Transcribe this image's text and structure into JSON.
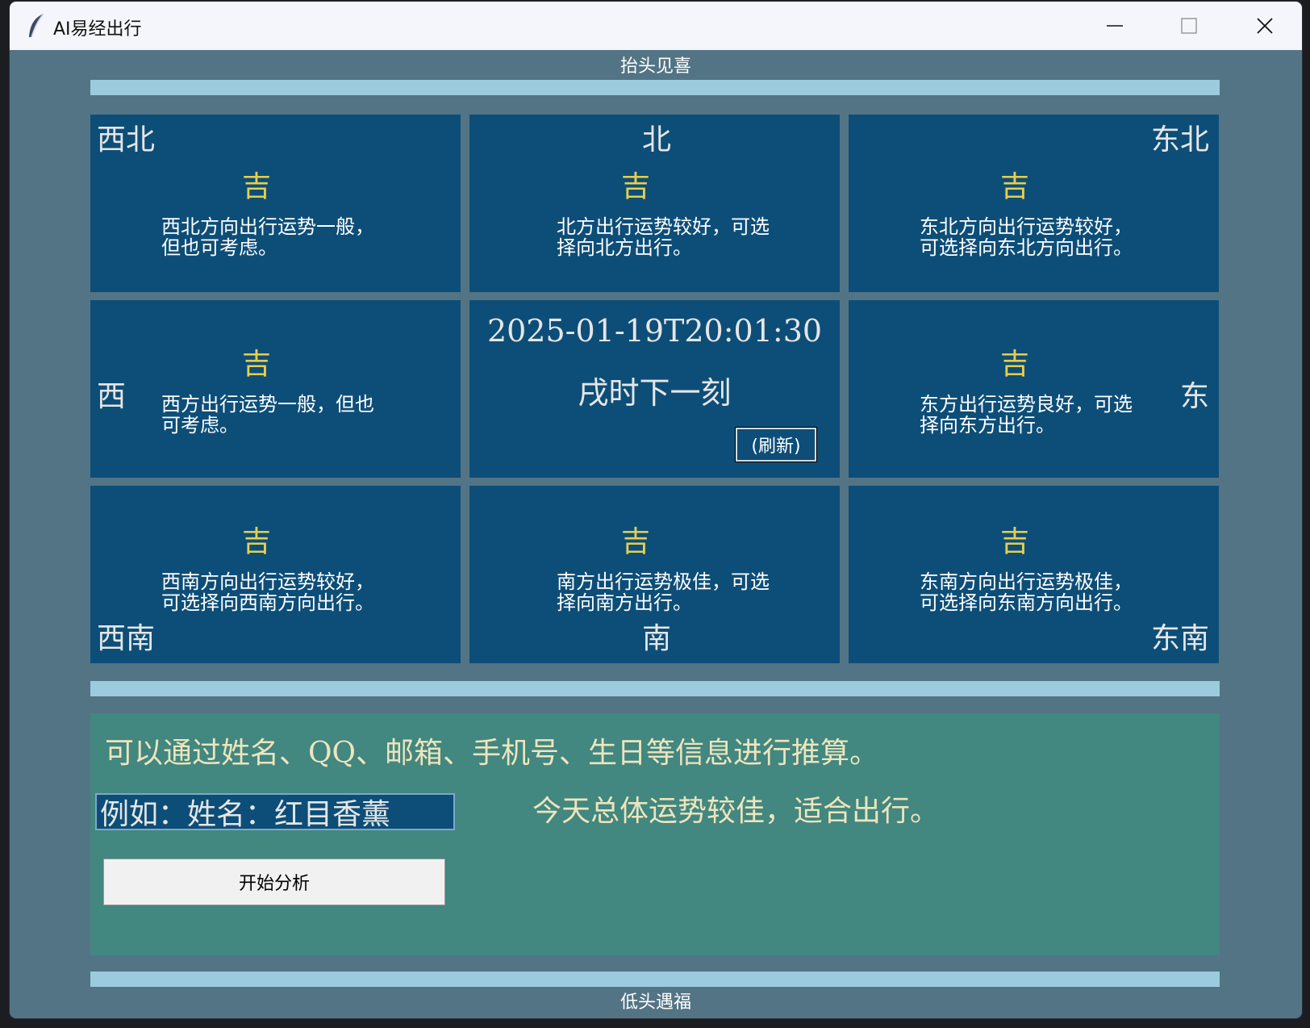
{
  "window": {
    "title": "AI易经出行"
  },
  "top_banner": "抬头见喜",
  "bottom_banner": "低头遇福",
  "grid": {
    "northwest": {
      "direction": "西北",
      "fortune": "吉",
      "desc": "西北方向出行运势一般，\n但也可考虑。"
    },
    "north": {
      "direction": "北",
      "fortune": "吉",
      "desc": "北方出行运势较好，可选\n择向北方出行。"
    },
    "northeast": {
      "direction": "东北",
      "fortune": "吉",
      "desc": "东北方向出行运势较好，\n可选择向东北方向出行。"
    },
    "west": {
      "direction": "西",
      "fortune": "吉",
      "desc": "西方出行运势一般，但也\n可考虑。"
    },
    "center": {
      "datetime": "2025-01-19T20:01:30",
      "shichen": "戌时下一刻",
      "refresh_label": "(刷新)"
    },
    "east": {
      "direction": "东",
      "fortune": "吉",
      "desc": "东方出行运势良好，可选\n择向东方出行。"
    },
    "southwest": {
      "direction": "西南",
      "fortune": "吉",
      "desc": "西南方向出行运势较好，\n可选择向西南方向出行。"
    },
    "south": {
      "direction": "南",
      "fortune": "吉",
      "desc": "南方出行运势极佳，可选\n择向南方出行。"
    },
    "southeast": {
      "direction": "东南",
      "fortune": "吉",
      "desc": "东南方向出行运势极佳，\n可选择向东南方向出行。"
    }
  },
  "analysis": {
    "hint": "可以通过姓名、QQ、邮箱、手机号、生日等信息进行推算。",
    "input_value": "例如：姓名：红目香薰",
    "result": "今天总体运势较佳，适合出行。",
    "button_label": "开始分析"
  },
  "colors": {
    "background": "#537485",
    "cell": "#0d4e78",
    "bar": "#9ccbdd",
    "panel": "#428780",
    "fortune_gold": "#e6cf4e"
  }
}
